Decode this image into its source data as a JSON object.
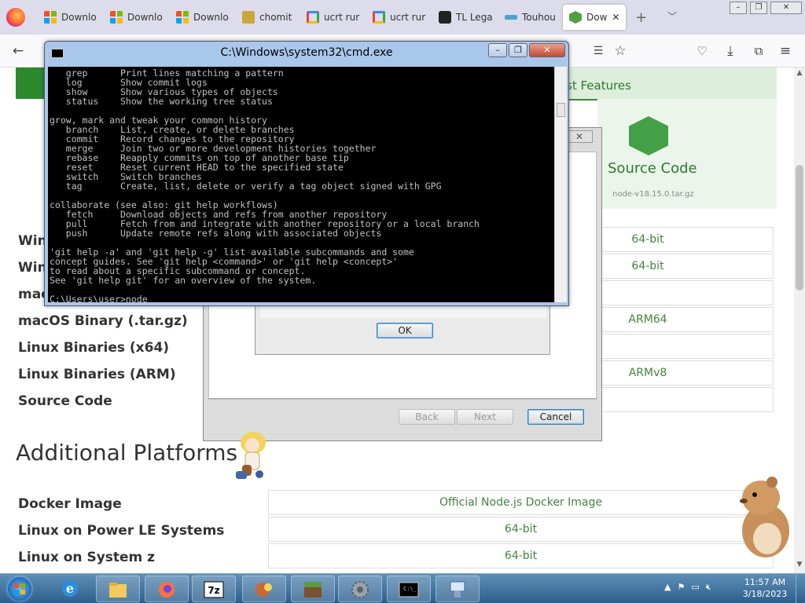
{
  "browser": {
    "tabs": [
      {
        "label": "Downlo",
        "icon": "microsoft-icon"
      },
      {
        "label": "Downlo",
        "icon": "microsoft-icon"
      },
      {
        "label": "Downlo",
        "icon": "microsoft-icon"
      },
      {
        "label": "chomit",
        "icon": "app-icon"
      },
      {
        "label": "ucrt rur",
        "icon": "google-icon"
      },
      {
        "label": "ucrt rur",
        "icon": "google-icon"
      },
      {
        "label": "TL Lega",
        "icon": "tl-icon"
      },
      {
        "label": "Touhou",
        "icon": "touhou-icon"
      },
      {
        "label": "Dow",
        "icon": "nodejs-icon",
        "active": true
      }
    ],
    "new_tab": "+",
    "window_controls": [
      "–",
      "❐",
      "✕"
    ]
  },
  "nodejs_page": {
    "latest_label": "st Features",
    "source_title": "Source Code",
    "source_file": "node-v18.15.0.tar.gz",
    "rows": [
      {
        "label": "Win",
        "cell": "64-bit"
      },
      {
        "label": "Win",
        "cell": "64-bit"
      },
      {
        "label": "mac",
        "cell": ""
      },
      {
        "label": "macOS Binary (.tar.gz)",
        "cell": "ARM64"
      },
      {
        "label": "Linux Binaries (x64)",
        "cell": ""
      },
      {
        "label": "Linux Binaries (ARM)",
        "cell": "ARMv8"
      },
      {
        "label": "Source Code",
        "cell": ""
      }
    ],
    "platforms_title": "Additional Platforms",
    "platform_rows": [
      {
        "label": "Docker Image",
        "cell": "Official Node.js Docker Image"
      },
      {
        "label": "Linux on Power LE Systems",
        "cell": "64-bit"
      },
      {
        "label": "Linux on System z",
        "cell": "64-bit"
      }
    ]
  },
  "installer": {
    "back": "Back",
    "next": "Next",
    "cancel": "Cancel",
    "ok": "OK"
  },
  "cmd": {
    "title": "C:\\Windows\\system32\\cmd.exe",
    "lines": [
      "   grep      Print lines matching a pattern",
      "   log       Show commit logs",
      "   show      Show various types of objects",
      "   status    Show the working tree status",
      "",
      "grow, mark and tweak your common history",
      "   branch    List, create, or delete branches",
      "   commit    Record changes to the repository",
      "   merge     Join two or more development histories together",
      "   rebase    Reapply commits on top of another base tip",
      "   reset     Reset current HEAD to the specified state",
      "   switch    Switch branches",
      "   tag       Create, list, delete or verify a tag object signed with GPG",
      "",
      "collaborate (see also: git help workflows)",
      "   fetch     Download objects and refs from another repository",
      "   pull      Fetch from and integrate with another repository or a local branch",
      "   push      Update remote refs along with associated objects",
      "",
      "'git help -a' and 'git help -g' list available subcommands and some",
      "concept guides. See 'git help <command>' or 'git help <concept>'",
      "to read about a specific subcommand or concept.",
      "See 'git help git' for an overview of the system.",
      "",
      "C:\\Users\\user>node"
    ]
  },
  "taskbar": {
    "items": [
      "internet-explorer-icon",
      "file-explorer-icon",
      "firefox-icon",
      "7zip-icon",
      "game-icon",
      "minecraft-icon",
      "settings-gear-icon",
      "cmd-icon",
      "network-installer-icon"
    ],
    "time": "11:57 AM",
    "date": "3/18/2023"
  },
  "colors": {
    "node_green": "#43853d",
    "taskbar_blue": "#2e5f8c",
    "console_bg": "#000000",
    "console_fg": "#c0c0c0"
  }
}
